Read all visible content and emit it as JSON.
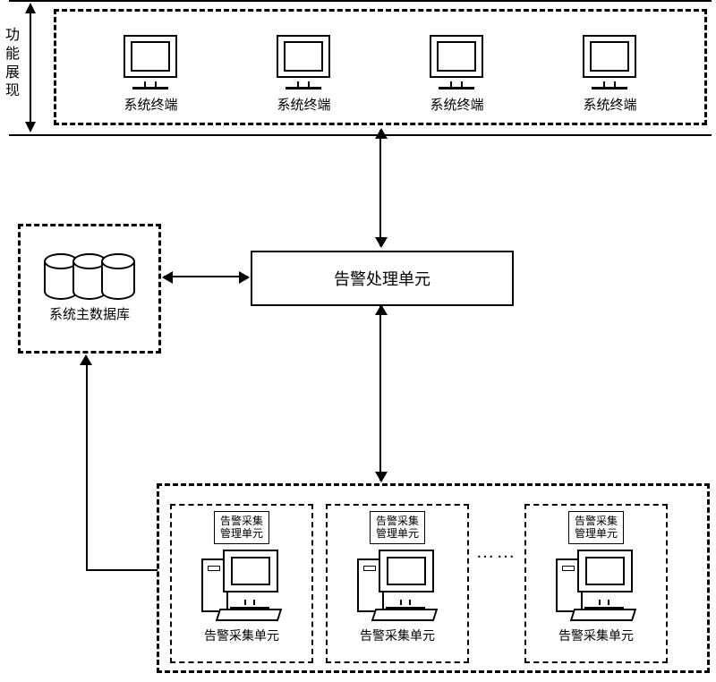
{
  "side_label": "功能展现",
  "terminals": {
    "label": "系统终端"
  },
  "database": {
    "label": "系统主数据库"
  },
  "processor": {
    "label": "告警处理单元"
  },
  "collector": {
    "mgmt_label": "告警采集\n管理单元",
    "unit_label": "告警采集单元"
  },
  "ellipsis": "……"
}
